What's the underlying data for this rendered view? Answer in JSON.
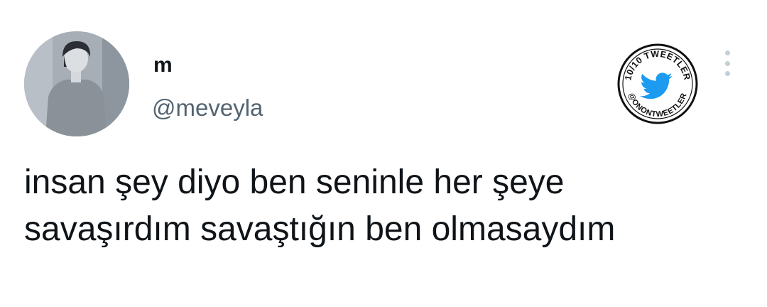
{
  "author": {
    "display_name": "m",
    "handle": "@meveyla",
    "avatar_icon": "person-photo-avatar"
  },
  "stamp": {
    "text_top": "10/10 TWEETLER",
    "text_bottom": "@ONONTWEETLER",
    "icon": "twitter-bird-icon",
    "bird_color": "#1d9bf0"
  },
  "more_icon": "more-vertical-icon",
  "tweet": {
    "lines": [
      "insan şey diyo ben seninle her şeye",
      "savaşırdım savaştığın ben olmasaydım"
    ]
  },
  "colors": {
    "text": "#0f1419",
    "secondary": "#536471",
    "dots": "#c4cfd6"
  }
}
